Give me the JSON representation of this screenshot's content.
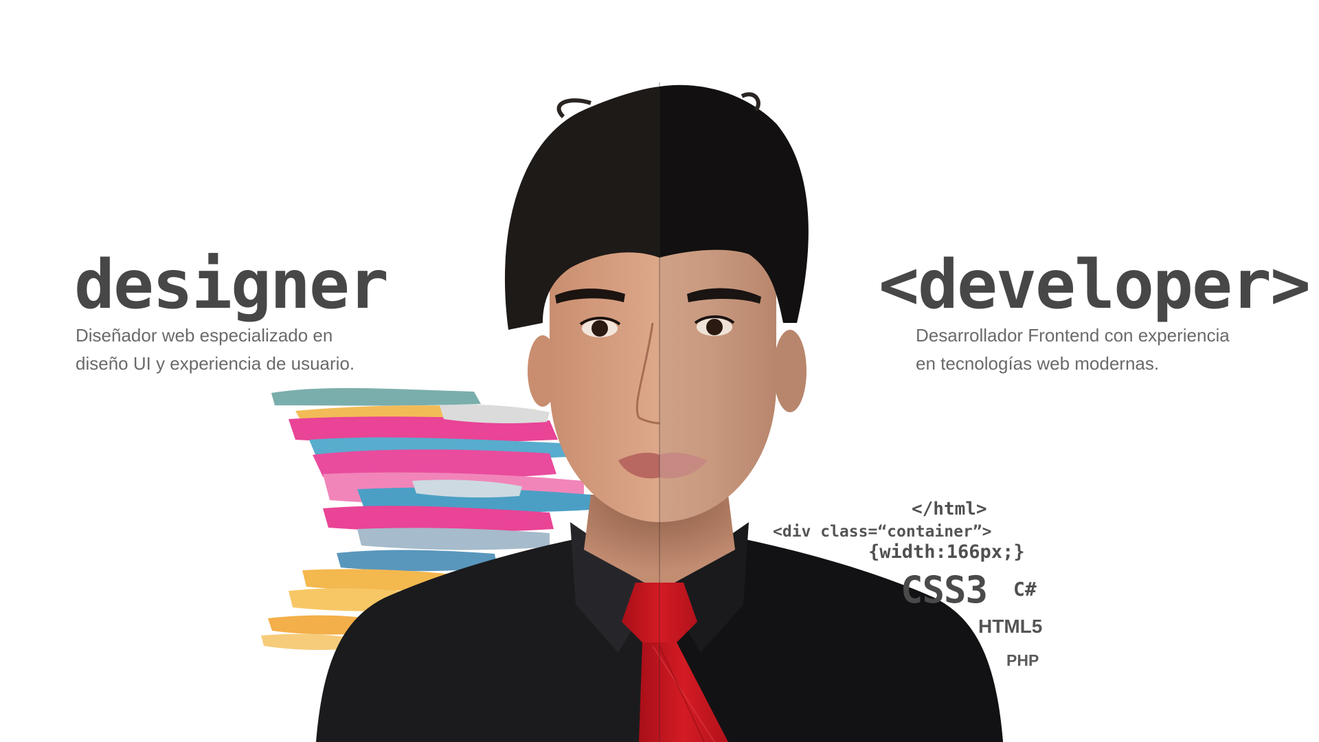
{
  "designer": {
    "title": "designer",
    "description_line1": "Diseñador web especializado en",
    "description_line2": "diseño UI y experiencia de usuario."
  },
  "developer": {
    "title": "<developer>",
    "description_line1": "Desarrollador Frontend con experiencia",
    "description_line2": "en tecnologías web modernas."
  },
  "code_snippets": [
    "</html>",
    "<div class=“container”>",
    "{width:166px;}",
    "CSS3",
    "C#",
    "HTML5",
    "PHP"
  ],
  "colors": {
    "background": "#ffffff",
    "title": "#474747",
    "description": "#6a6a6a",
    "tie": "#c8141c",
    "shirt": "#1b1b1d",
    "paint_pink": "#e8358e",
    "paint_teal": "#4aa6c9",
    "paint_yellow": "#f5b63c"
  },
  "icons": {
    "portrait": "split-portrait-illustration",
    "paint": "paint-strokes-decoration"
  }
}
